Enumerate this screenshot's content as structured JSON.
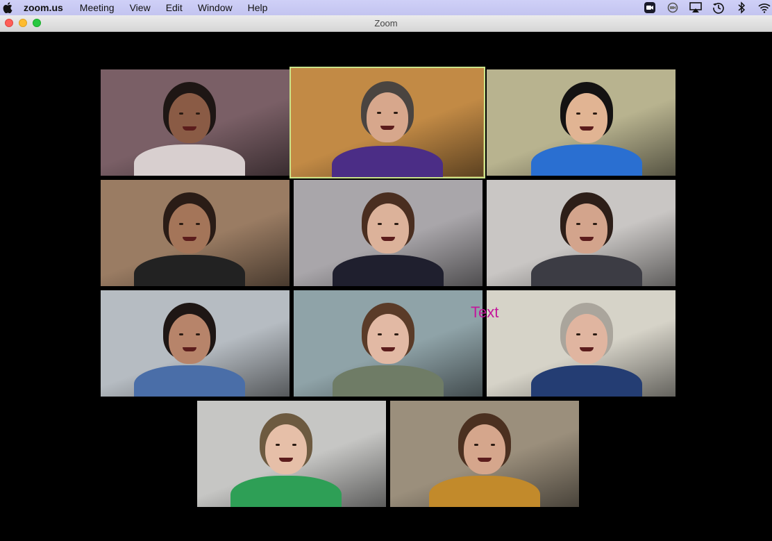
{
  "menubar": {
    "app_name": "zoom.us",
    "items": [
      "Meeting",
      "View",
      "Edit",
      "Window",
      "Help"
    ],
    "status_icons": [
      "zoom-status-icon",
      "camera-off-icon",
      "airplay-icon",
      "time-machine-icon",
      "bluetooth-icon",
      "wifi-icon"
    ]
  },
  "window": {
    "title": "Zoom"
  },
  "overlay": {
    "annotation_text": "Text"
  },
  "colors": {
    "active_speaker_border": "#cbe48a",
    "background": "#000000",
    "annotation": "#c3179b"
  },
  "participants": [
    {
      "id": "p1",
      "bg": "#7a5f66",
      "skin": "#8a5b45",
      "hair": "#1e1614",
      "shirt": "#d8cfcf",
      "active": false
    },
    {
      "id": "p2",
      "bg": "#c28a45",
      "skin": "#d7a78c",
      "hair": "#4a4440",
      "shirt": "#4b2d86",
      "active": true
    },
    {
      "id": "p3",
      "bg": "#b8b38f",
      "skin": "#e1b493",
      "hair": "#141212",
      "shirt": "#2a6fd1",
      "active": false
    },
    {
      "id": "p4",
      "bg": "#9a7c63",
      "skin": "#a47559",
      "hair": "#2a1c16",
      "shirt": "#222222",
      "active": false
    },
    {
      "id": "p5",
      "bg": "#a9a6aa",
      "skin": "#dcb29a",
      "hair": "#4a2e20",
      "shirt": "#1f1f2e",
      "active": false
    },
    {
      "id": "p6",
      "bg": "#c9c6c4",
      "skin": "#d3a48c",
      "hair": "#2d1e18",
      "shirt": "#3c3c44",
      "active": false
    },
    {
      "id": "p7",
      "bg": "#b6bcc2",
      "skin": "#b7846a",
      "hair": "#1e1614",
      "shirt": "#4a6ea8",
      "active": false
    },
    {
      "id": "p8",
      "bg": "#8fa3a8",
      "skin": "#e2b9a4",
      "hair": "#5a3b28",
      "shirt": "#6f7c66",
      "active": false
    },
    {
      "id": "p9",
      "bg": "#d6d3c8",
      "skin": "#e0b5a0",
      "hair": "#aaa59c",
      "shirt": "#243d73",
      "active": false
    },
    {
      "id": "p10",
      "bg": "#c6c6c4",
      "skin": "#e6bfa8",
      "hair": "#6d5a40",
      "shirt": "#2e9f56",
      "active": false
    },
    {
      "id": "p11",
      "bg": "#9b8f7c",
      "skin": "#d5a68c",
      "hair": "#4b3020",
      "shirt": "#c28a2b",
      "active": false
    }
  ]
}
